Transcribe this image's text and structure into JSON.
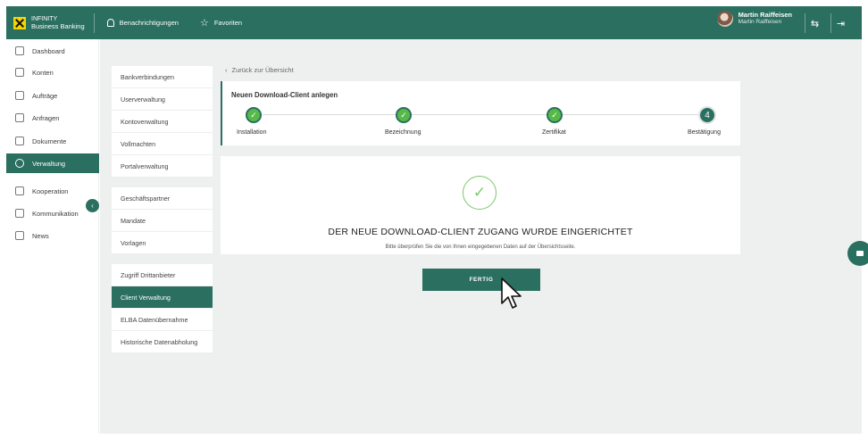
{
  "brand": {
    "line1": "INFINITY",
    "line2": "Business Banking",
    "accent": "#2a6f60",
    "logo_color": "#f5d400"
  },
  "topnav": {
    "notifications": "Benachrichtigungen",
    "favorites": "Favoriten"
  },
  "user": {
    "name": "Martin Raiffeisen",
    "subname": "Martin Raiffeisen"
  },
  "topbar_icons": {
    "switch": "⇆",
    "logout": "⇥"
  },
  "sidebar": {
    "items": [
      {
        "label": "Dashboard",
        "icon": "grid-icon"
      },
      {
        "label": "Konten",
        "icon": "wallet-icon"
      },
      {
        "label": "Aufträge",
        "icon": "transfer-icon"
      },
      {
        "label": "Anfragen",
        "icon": "request-icon"
      },
      {
        "label": "Dokumente",
        "icon": "document-icon"
      },
      {
        "label": "Verwaltung",
        "icon": "gear-icon",
        "active": true
      },
      {
        "label": "Kooperation",
        "icon": "handshake-icon"
      },
      {
        "label": "Kommunikation",
        "icon": "chat-icon"
      },
      {
        "label": "News",
        "icon": "news-icon"
      }
    ],
    "collapse_glyph": "‹"
  },
  "submenu": {
    "group1": [
      "Bankverbindungen",
      "Userverwaltung",
      "Kontoverwaltung",
      "Vollmachten",
      "Portalverwaltung"
    ],
    "group2": [
      "Geschäftspartner",
      "Mandate",
      "Vorlagen"
    ],
    "group3": [
      "Zugriff Drittanbieter",
      "Client Verwaltung",
      "ELBA Datenübernahme",
      "Historische Datenabholung"
    ],
    "active": "Client Verwaltung"
  },
  "back_link": "Zurück zur Übersicht",
  "stepper": {
    "title": "Neuen Download-Client anlegen",
    "steps": [
      {
        "label": "Installation",
        "done": true
      },
      {
        "label": "Bezeichnung",
        "done": true
      },
      {
        "label": "Zertifikat",
        "done": true
      },
      {
        "label": "Bestätigung",
        "number": "4",
        "done": false
      }
    ],
    "check_glyph": "✓"
  },
  "result": {
    "check_glyph": "✓",
    "title": "DER NEUE DOWNLOAD-CLIENT ZUGANG WURDE EINGERICHTET",
    "subtitle": "Bitte überprüfen Sie die von Ihnen eingegebenen Daten auf der Übersichtsseite."
  },
  "button": {
    "finish": "FERTIG"
  }
}
